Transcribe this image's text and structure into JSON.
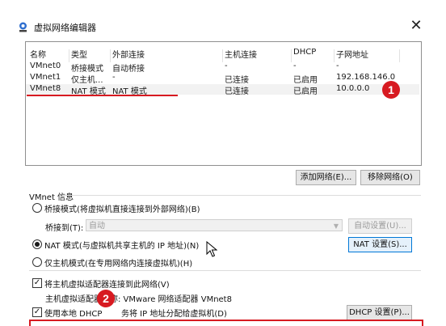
{
  "window": {
    "title": "虚拟网络编辑器",
    "close_glyph": "✕"
  },
  "network_list": {
    "columns": [
      "名称",
      "类型",
      "外部连接",
      "主机连接",
      "DHCP",
      "子网地址"
    ],
    "rows": [
      {
        "name": "VMnet0",
        "type": "桥接模式",
        "external": "自动桥接",
        "host": "-",
        "dhcp": "-",
        "subnet": "-"
      },
      {
        "name": "VMnet1",
        "type": "仅主机...",
        "external": "-",
        "host": "已连接",
        "dhcp": "已启用",
        "subnet": "192.168.146.0"
      },
      {
        "name": "VMnet8",
        "type": "NAT 模式",
        "external": "NAT 模式",
        "host": "已连接",
        "dhcp": "已启用",
        "subnet": "10.0.0.0"
      }
    ],
    "selected_row": "VMnet8"
  },
  "buttons": {
    "add_network": "添加网络(E)...",
    "remove_network": "移除网络(O)",
    "auto_settings": "自动设置(U)...",
    "nat_settings": "NAT 设置(S)...",
    "dhcp_settings": "DHCP 设置(P)..."
  },
  "vmnet_info": {
    "section_label": "VMnet 信息",
    "bridged_option": "桥接模式(将虚拟机直接连接到外部网络)(B)",
    "bridged_to_label": "桥接到(T):",
    "bridged_to_value": "自动",
    "nat_option": "NAT 模式(与虚拟机共享主机的 IP 地址)(N)",
    "hostonly_option": "仅主机模式(在专用网络内连接虚拟机)(H)",
    "selected_mode": "nat",
    "connect_adapter_option": "将主机虚拟适配器连接到此网络(V)",
    "adapter_name_text": "主机虚拟适配器名称: VMware 网络适配器 VMnet8",
    "adapter_name_visible": "主机虚拟适配器",
    "adapter_name_tail": "称: VMware 网络适配器 VMnet8",
    "dhcp_option_pre": "使用本地 DHCP ",
    "dhcp_option_post": "务将 IP 地址分配给虚拟机(D)",
    "connect_adapter_checked": true,
    "dhcp_checked": true
  },
  "annotations": {
    "badge1": "1",
    "badge2": "2",
    "color": "#d71a21"
  }
}
